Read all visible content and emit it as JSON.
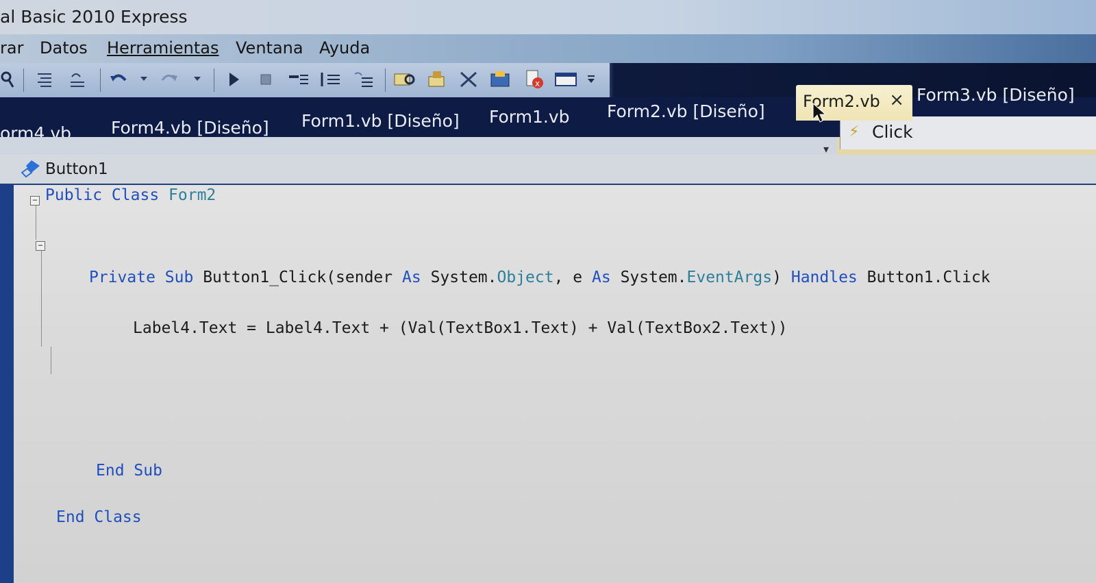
{
  "window": {
    "title": "al Basic 2010 Express"
  },
  "menu": {
    "items": [
      "rar",
      "Datos",
      "Herramientas",
      "Ventana",
      "Ayuda"
    ]
  },
  "toolbar": {
    "icons": [
      "find-icon",
      "comment-icon",
      "uncomment-icon",
      "undo-icon",
      "redo-icon",
      "start-debug-icon",
      "stop-icon",
      "step-into-icon",
      "step-over-icon",
      "step-out-icon",
      "find-in-files-icon",
      "object-browser-icon",
      "tools-icon",
      "toolbox-icon",
      "error-list-icon",
      "output-icon",
      "overflow-icon"
    ]
  },
  "tabs": {
    "items": [
      "orm4.vb",
      "Form4.vb [Diseño]",
      "Form1.vb [Diseño]",
      "Form1.vb",
      "Form2.vb [Diseño]",
      "Form3.vb [Diseño]"
    ],
    "active": "Form2.vb",
    "close_glyph": "×"
  },
  "navbar": {
    "object": "Button1",
    "event": "Click"
  },
  "code": {
    "line1_kw": "Public Class",
    "line1_name": "Form2",
    "line2_kw1": "Private Sub",
    "line2_a": "Button1_Click(sender",
    "line2_as1": "As",
    "line2_sys1": "System.",
    "line2_obj": "Object",
    "line2_b": ", e",
    "line2_as2": "As",
    "line2_sys2": "System.",
    "line2_evt": "EventArgs",
    "line2_c": ")",
    "line2_handles": "Handles",
    "line2_d": "Button1.Click",
    "line3": "Label4.Text = Label4.Text + (Val(TextBox1.Text) + Val(TextBox2.Text))",
    "line4": "End Sub",
    "line5": "End Class"
  },
  "colors": {
    "keyword": "#1f4fbf",
    "type": "#2b7f9a",
    "tabbar": "#0e1b45",
    "active_tab": "#f7f1d2"
  }
}
